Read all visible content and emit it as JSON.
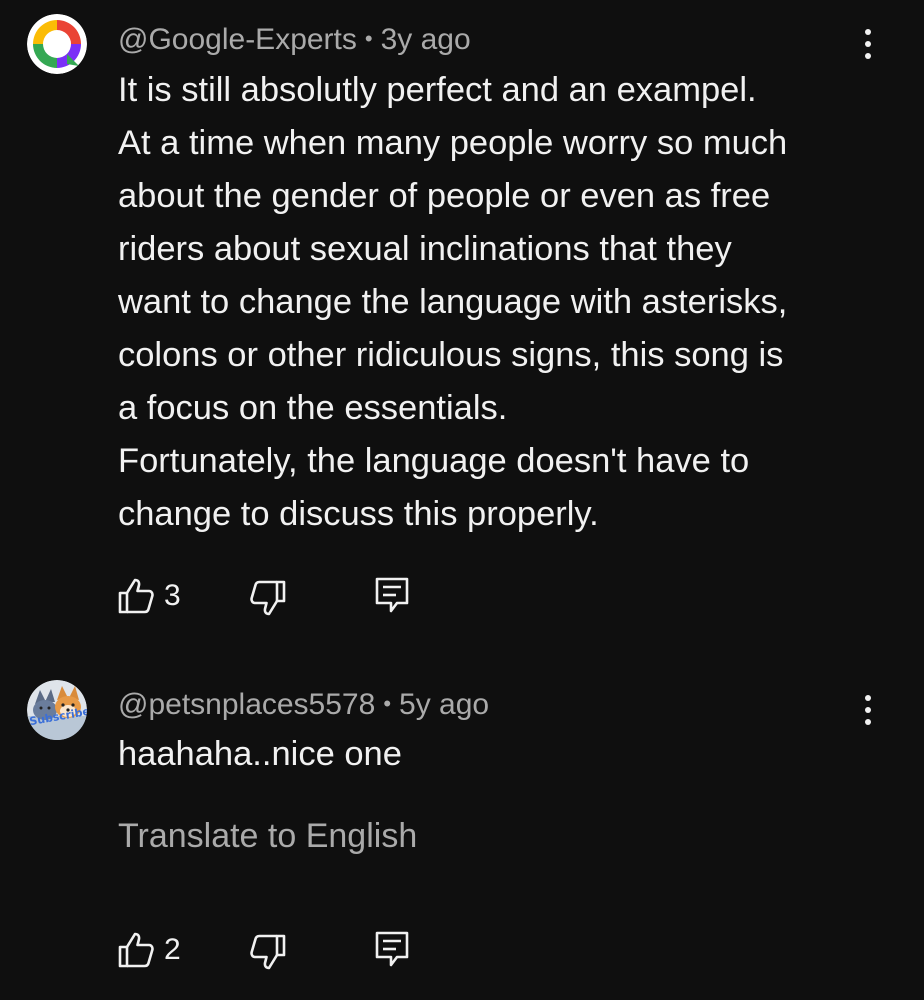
{
  "comments": [
    {
      "author": "@Google-Experts",
      "separator": "•",
      "time": "3y ago",
      "avatar_icon": "ring-logo-avatar",
      "lines": [
        "It is still absolutly perfect and an exampel.",
        "At a time when many people worry so much",
        "about the gender of people or even as free",
        "riders about sexual inclinations that they",
        "want to change the language with asterisks,",
        "colons or other ridiculous signs, this song is",
        "a focus on the essentials.",
        "Fortunately, the language doesn't have to",
        "change to discuss this properly."
      ],
      "likes": "3"
    },
    {
      "author": "@petsnplaces5578",
      "separator": "•",
      "time": "5y ago",
      "avatar_icon": "cat-dog-avatar",
      "avatar_text": "Subscribe",
      "lines": [
        "haahaha..nice one"
      ],
      "translate_label": "Translate to English",
      "likes": "2"
    }
  ],
  "icons": {
    "like": "thumbs-up-icon",
    "dislike": "thumbs-down-icon",
    "reply": "reply-icon",
    "more": "more-vert-icon"
  },
  "colors": {
    "background": "#0f0f0f",
    "primary_text": "#f1f1f1",
    "secondary_text": "#aaaaaa"
  }
}
